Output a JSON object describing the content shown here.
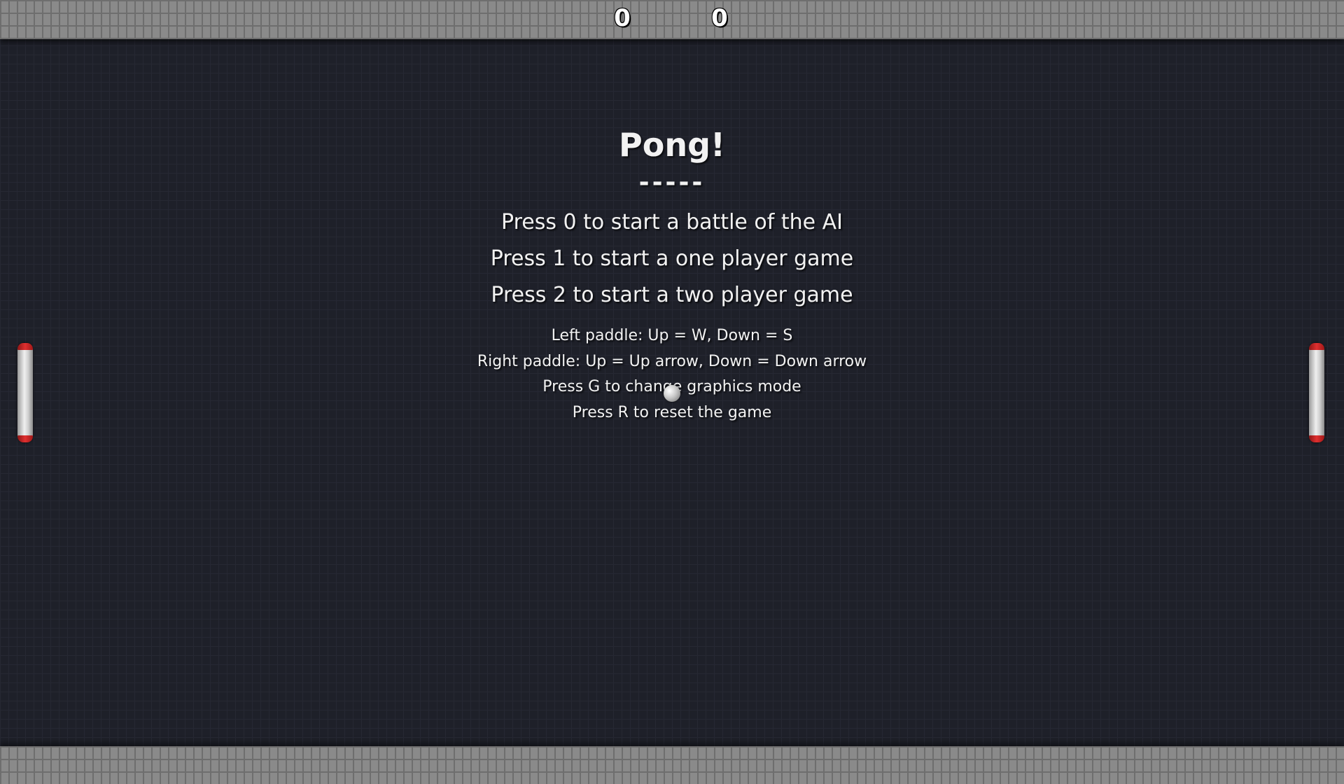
{
  "scores": {
    "left": "0",
    "right": "0"
  },
  "menu": {
    "title": "Pong!",
    "divider": "-----",
    "options": [
      "Press 0 to start a battle of the AI",
      "Press 1 to start a one player game",
      "Press 2 to start a two player game"
    ],
    "controls": [
      "Left paddle: Up = W, Down = S",
      "Right paddle: Up = Up arrow, Down = Down arrow",
      "Press G to change graphics mode",
      "Press R to reset the game"
    ]
  },
  "colors": {
    "background": "#1e2029",
    "wall": "#8a8a8a",
    "paddle_cap": "#e03030",
    "text": "#f2f2f2"
  }
}
